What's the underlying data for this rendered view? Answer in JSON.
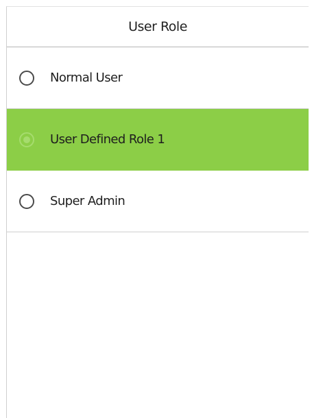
{
  "header": {
    "title": "User Role"
  },
  "options": [
    {
      "label": "Normal User",
      "selected": false
    },
    {
      "label": "User Defined Role 1",
      "selected": true
    },
    {
      "label": "Super Admin",
      "selected": false
    }
  ],
  "colors": {
    "selected_row": "#8cce47",
    "selected_radio": "#a6dc6e",
    "divider": "#cfcfcf"
  }
}
